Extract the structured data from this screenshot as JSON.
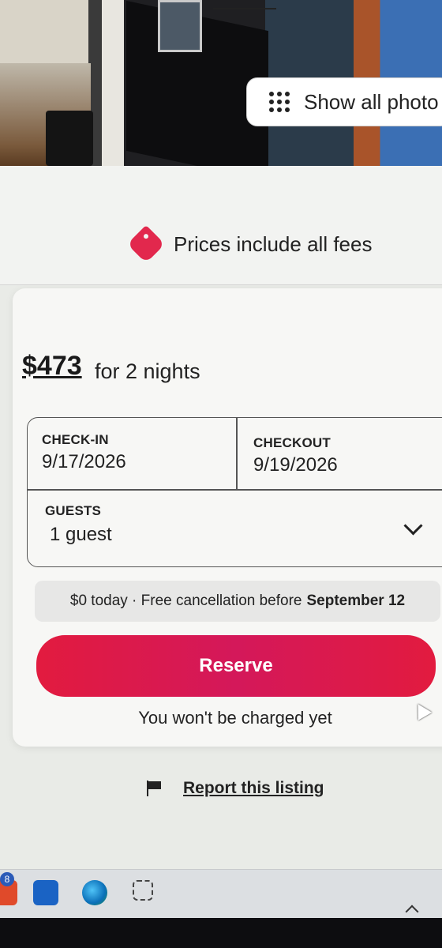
{
  "gallery": {
    "show_all_label": "Show all photo"
  },
  "fees_notice": {
    "text": "Prices include all fees"
  },
  "pricing": {
    "total": "$473",
    "duration": "for 2 nights"
  },
  "booking": {
    "checkin_label": "CHECK-IN",
    "checkin_value": "9/17/2026",
    "checkout_label": "CHECKOUT",
    "checkout_value": "9/19/2026",
    "guests_label": "GUESTS",
    "guests_value": "1 guest"
  },
  "cancellation": {
    "prefix": "$0 today · Free cancellation before",
    "date": "September 12"
  },
  "reserve": {
    "button_label": "Reserve",
    "note": "You won't be charged yet"
  },
  "report": {
    "link_label": "Report this listing"
  },
  "taskbar": {
    "badge_count": "8"
  },
  "colors": {
    "brand": "#e21b3f",
    "text": "#222222"
  }
}
